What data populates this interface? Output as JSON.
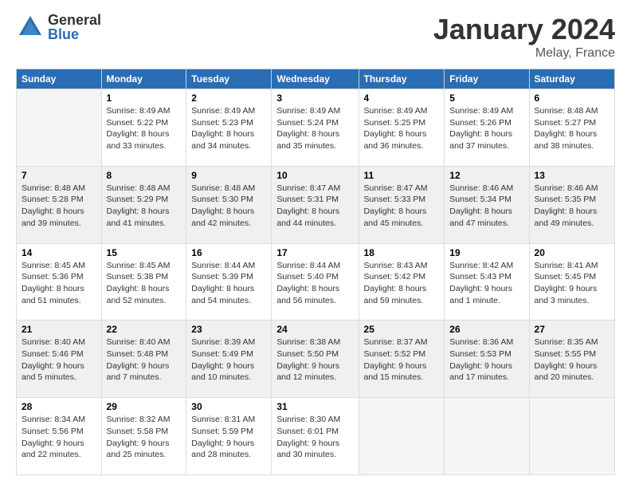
{
  "header": {
    "logo_general": "General",
    "logo_blue": "Blue",
    "month": "January 2024",
    "location": "Melay, France"
  },
  "weekdays": [
    "Sunday",
    "Monday",
    "Tuesday",
    "Wednesday",
    "Thursday",
    "Friday",
    "Saturday"
  ],
  "weeks": [
    [
      {
        "day": "",
        "sunrise": "",
        "sunset": "",
        "daylight": "",
        "empty": true
      },
      {
        "day": "1",
        "sunrise": "Sunrise: 8:49 AM",
        "sunset": "Sunset: 5:22 PM",
        "daylight": "Daylight: 8 hours and 33 minutes."
      },
      {
        "day": "2",
        "sunrise": "Sunrise: 8:49 AM",
        "sunset": "Sunset: 5:23 PM",
        "daylight": "Daylight: 8 hours and 34 minutes."
      },
      {
        "day": "3",
        "sunrise": "Sunrise: 8:49 AM",
        "sunset": "Sunset: 5:24 PM",
        "daylight": "Daylight: 8 hours and 35 minutes."
      },
      {
        "day": "4",
        "sunrise": "Sunrise: 8:49 AM",
        "sunset": "Sunset: 5:25 PM",
        "daylight": "Daylight: 8 hours and 36 minutes."
      },
      {
        "day": "5",
        "sunrise": "Sunrise: 8:49 AM",
        "sunset": "Sunset: 5:26 PM",
        "daylight": "Daylight: 8 hours and 37 minutes."
      },
      {
        "day": "6",
        "sunrise": "Sunrise: 8:48 AM",
        "sunset": "Sunset: 5:27 PM",
        "daylight": "Daylight: 8 hours and 38 minutes."
      }
    ],
    [
      {
        "day": "7",
        "sunrise": "Sunrise: 8:48 AM",
        "sunset": "Sunset: 5:28 PM",
        "daylight": "Daylight: 8 hours and 39 minutes."
      },
      {
        "day": "8",
        "sunrise": "Sunrise: 8:48 AM",
        "sunset": "Sunset: 5:29 PM",
        "daylight": "Daylight: 8 hours and 41 minutes."
      },
      {
        "day": "9",
        "sunrise": "Sunrise: 8:48 AM",
        "sunset": "Sunset: 5:30 PM",
        "daylight": "Daylight: 8 hours and 42 minutes."
      },
      {
        "day": "10",
        "sunrise": "Sunrise: 8:47 AM",
        "sunset": "Sunset: 5:31 PM",
        "daylight": "Daylight: 8 hours and 44 minutes."
      },
      {
        "day": "11",
        "sunrise": "Sunrise: 8:47 AM",
        "sunset": "Sunset: 5:33 PM",
        "daylight": "Daylight: 8 hours and 45 minutes."
      },
      {
        "day": "12",
        "sunrise": "Sunrise: 8:46 AM",
        "sunset": "Sunset: 5:34 PM",
        "daylight": "Daylight: 8 hours and 47 minutes."
      },
      {
        "day": "13",
        "sunrise": "Sunrise: 8:46 AM",
        "sunset": "Sunset: 5:35 PM",
        "daylight": "Daylight: 8 hours and 49 minutes."
      }
    ],
    [
      {
        "day": "14",
        "sunrise": "Sunrise: 8:45 AM",
        "sunset": "Sunset: 5:36 PM",
        "daylight": "Daylight: 8 hours and 51 minutes."
      },
      {
        "day": "15",
        "sunrise": "Sunrise: 8:45 AM",
        "sunset": "Sunset: 5:38 PM",
        "daylight": "Daylight: 8 hours and 52 minutes."
      },
      {
        "day": "16",
        "sunrise": "Sunrise: 8:44 AM",
        "sunset": "Sunset: 5:39 PM",
        "daylight": "Daylight: 8 hours and 54 minutes."
      },
      {
        "day": "17",
        "sunrise": "Sunrise: 8:44 AM",
        "sunset": "Sunset: 5:40 PM",
        "daylight": "Daylight: 8 hours and 56 minutes."
      },
      {
        "day": "18",
        "sunrise": "Sunrise: 8:43 AM",
        "sunset": "Sunset: 5:42 PM",
        "daylight": "Daylight: 8 hours and 59 minutes."
      },
      {
        "day": "19",
        "sunrise": "Sunrise: 8:42 AM",
        "sunset": "Sunset: 5:43 PM",
        "daylight": "Daylight: 9 hours and 1 minute."
      },
      {
        "day": "20",
        "sunrise": "Sunrise: 8:41 AM",
        "sunset": "Sunset: 5:45 PM",
        "daylight": "Daylight: 9 hours and 3 minutes."
      }
    ],
    [
      {
        "day": "21",
        "sunrise": "Sunrise: 8:40 AM",
        "sunset": "Sunset: 5:46 PM",
        "daylight": "Daylight: 9 hours and 5 minutes."
      },
      {
        "day": "22",
        "sunrise": "Sunrise: 8:40 AM",
        "sunset": "Sunset: 5:48 PM",
        "daylight": "Daylight: 9 hours and 7 minutes."
      },
      {
        "day": "23",
        "sunrise": "Sunrise: 8:39 AM",
        "sunset": "Sunset: 5:49 PM",
        "daylight": "Daylight: 9 hours and 10 minutes."
      },
      {
        "day": "24",
        "sunrise": "Sunrise: 8:38 AM",
        "sunset": "Sunset: 5:50 PM",
        "daylight": "Daylight: 9 hours and 12 minutes."
      },
      {
        "day": "25",
        "sunrise": "Sunrise: 8:37 AM",
        "sunset": "Sunset: 5:52 PM",
        "daylight": "Daylight: 9 hours and 15 minutes."
      },
      {
        "day": "26",
        "sunrise": "Sunrise: 8:36 AM",
        "sunset": "Sunset: 5:53 PM",
        "daylight": "Daylight: 9 hours and 17 minutes."
      },
      {
        "day": "27",
        "sunrise": "Sunrise: 8:35 AM",
        "sunset": "Sunset: 5:55 PM",
        "daylight": "Daylight: 9 hours and 20 minutes."
      }
    ],
    [
      {
        "day": "28",
        "sunrise": "Sunrise: 8:34 AM",
        "sunset": "Sunset: 5:56 PM",
        "daylight": "Daylight: 9 hours and 22 minutes."
      },
      {
        "day": "29",
        "sunrise": "Sunrise: 8:32 AM",
        "sunset": "Sunset: 5:58 PM",
        "daylight": "Daylight: 9 hours and 25 minutes."
      },
      {
        "day": "30",
        "sunrise": "Sunrise: 8:31 AM",
        "sunset": "Sunset: 5:59 PM",
        "daylight": "Daylight: 9 hours and 28 minutes."
      },
      {
        "day": "31",
        "sunrise": "Sunrise: 8:30 AM",
        "sunset": "Sunset: 6:01 PM",
        "daylight": "Daylight: 9 hours and 30 minutes."
      },
      {
        "day": "",
        "sunrise": "",
        "sunset": "",
        "daylight": "",
        "empty": true
      },
      {
        "day": "",
        "sunrise": "",
        "sunset": "",
        "daylight": "",
        "empty": true
      },
      {
        "day": "",
        "sunrise": "",
        "sunset": "",
        "daylight": "",
        "empty": true
      }
    ]
  ]
}
